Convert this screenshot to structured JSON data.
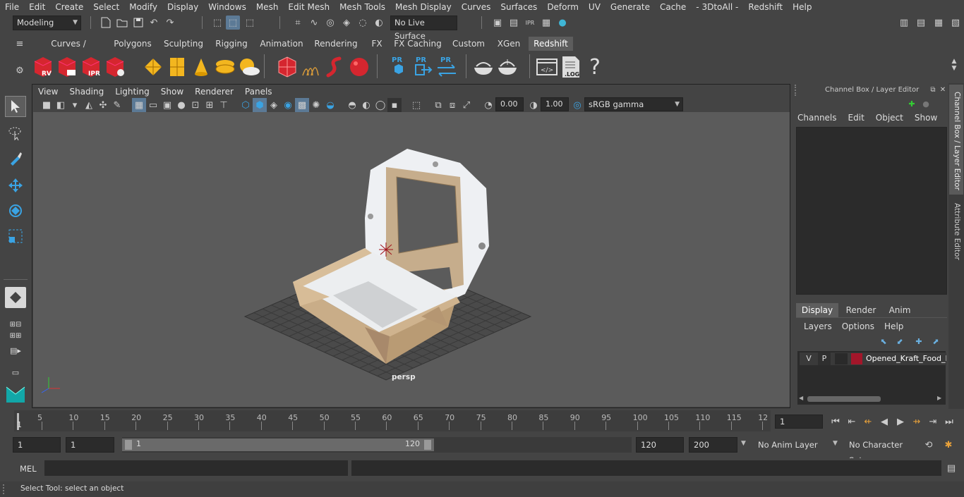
{
  "menubar": [
    "File",
    "Edit",
    "Create",
    "Select",
    "Modify",
    "Display",
    "Windows",
    "Mesh",
    "Edit Mesh",
    "Mesh Tools",
    "Mesh Display",
    "Curves",
    "Surfaces",
    "Deform",
    "UV",
    "Generate",
    "Cache",
    "- 3DtoAll -",
    "Redshift",
    "Help"
  ],
  "status": {
    "mode": "Modeling",
    "live_surface": "No Live Surface"
  },
  "shelf_tabs": [
    "Curves / Surfaces",
    "Polygons",
    "Sculpting",
    "Rigging",
    "Animation",
    "Rendering",
    "FX",
    "FX Caching",
    "Custom",
    "XGen",
    "Redshift"
  ],
  "shelf_active": "Redshift",
  "shelf_labels": {
    "rv": "RV",
    "ipr": "IPR",
    "pr1": "PR",
    "pr2": "PR",
    "pr3": "PR",
    "log": ".LOG",
    "help": "?"
  },
  "viewport": {
    "menu": [
      "View",
      "Shading",
      "Lighting",
      "Show",
      "Renderer",
      "Panels"
    ],
    "exposure": "0.00",
    "gamma": "1.00",
    "color_space": "sRGB gamma",
    "camera_label": "persp"
  },
  "channel_box": {
    "title": "Channel Box / Layer Editor",
    "menu": [
      "Channels",
      "Edit",
      "Object",
      "Show"
    ],
    "layer_tabs": [
      "Display",
      "Render",
      "Anim"
    ],
    "layer_menu": [
      "Layers",
      "Options",
      "Help"
    ],
    "layer": {
      "v": "V",
      "p": "P",
      "name": "Opened_Kraft_Food_B",
      "color": "#a3162a"
    }
  },
  "side_tabs": [
    "Channel Box / Layer Editor",
    "Attribute Editor"
  ],
  "timeline": {
    "ticks": [
      "5",
      "10",
      "15",
      "20",
      "25",
      "30",
      "35",
      "40",
      "45",
      "50",
      "55",
      "60",
      "65",
      "70",
      "75",
      "80",
      "85",
      "90",
      "95",
      "100",
      "105",
      "110",
      "115",
      "12"
    ],
    "start_marker": "1",
    "current_frame": "1"
  },
  "range": {
    "start": "1",
    "anim_start": "1",
    "slider_start": "1",
    "slider_end": "120",
    "end": "120",
    "anim_end": "200",
    "anim_layer": "No Anim Layer",
    "char_set": "No Character Set"
  },
  "cmd": {
    "lang": "MEL"
  },
  "help_text": "Select Tool: select an object"
}
